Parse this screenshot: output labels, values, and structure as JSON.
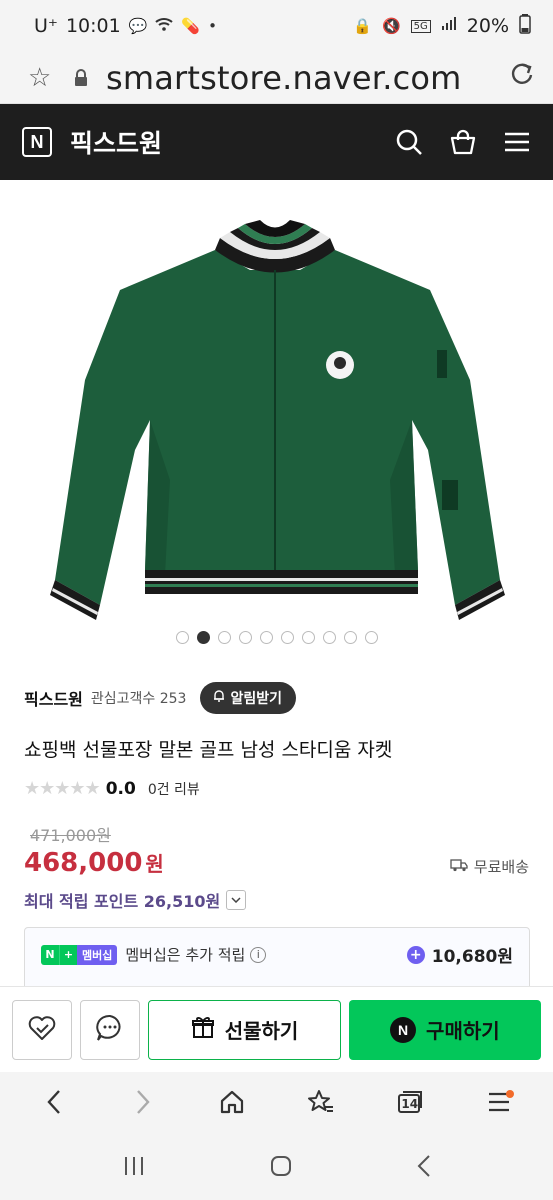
{
  "status_bar": {
    "carrier": "U⁺",
    "time": "10:01",
    "battery": "20%"
  },
  "browser": {
    "url": "smartstore.naver.com"
  },
  "store_header": {
    "logo": "N",
    "store_name": "픽스드원"
  },
  "product": {
    "image_dots_total": 10,
    "image_dots_active": 2,
    "store_name": "픽스드원",
    "fans_label": "관심고객수 253",
    "alert_button": "알림받기",
    "title": "쇼핑백 선물포장 말본 골프 남성 스타디움 자켓",
    "stars": "★★★★★",
    "rating": "0.0",
    "review_count": "0건 리뷰",
    "original_price": "471,000원",
    "price": "468,000",
    "price_unit": "원",
    "shipping": "무료배송",
    "max_points": "최대 적립 포인트 26,510원",
    "membership": {
      "badge_n": "N",
      "badge_plus": "+",
      "badge_label": "멤버십",
      "text": "멤버십은 추가 적립",
      "info_icon": "i",
      "points": "10,680원"
    }
  },
  "actions": {
    "gift_label": "선물하기",
    "buy_label": "구매하기",
    "buy_logo": "N"
  },
  "browser_nav": {
    "tab_count": "14"
  },
  "colors": {
    "header_bg": "#1e1e1e",
    "price_red": "#c62f3f",
    "naver_green": "#03c75a",
    "membership_purple": "#6f5ff0",
    "points_purple": "#5b4a8b",
    "jacket_green": "#1d5e3c"
  }
}
